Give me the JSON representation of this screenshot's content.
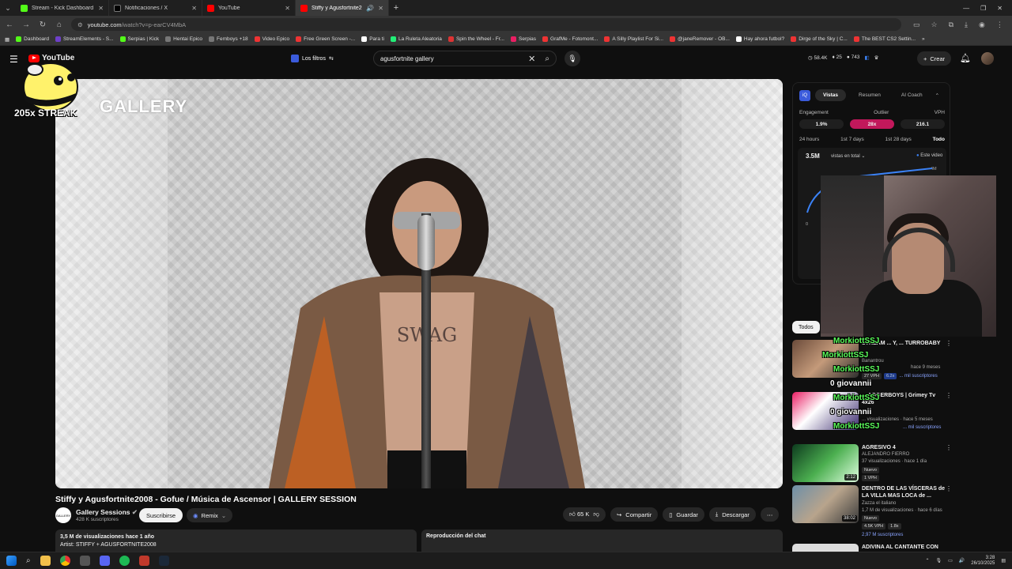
{
  "browser": {
    "tabs": [
      {
        "title": "Stream - Kick Dashboard",
        "color": "#53fc18"
      },
      {
        "title": "Notificaciones / X",
        "color": "#ffffff"
      },
      {
        "title": "YouTube",
        "color": "#ff0000"
      },
      {
        "title": "Stiffy y Agusfortnite2008",
        "color": "#ff0000"
      }
    ],
    "url_domain": "youtube.com",
    "url_path": "/watch?v=p-earCV4MbA",
    "bookmarks": [
      "Dashboard",
      "StreamElements - S...",
      "Serpias | Kick",
      "Hentai Epico",
      "Femboys +18",
      "Video Epico",
      "Free Green Screen -...",
      "Para ti",
      "La Ruleta Aleatoria",
      "Spin the Wheel - Fr...",
      "Serpias",
      "GrafMe - Fotomont...",
      "A Silly Playlist For Si...",
      "@janeRemover - OB...",
      "Hay ahora futbol?",
      "Dirge of the Sky | C...",
      "The BEST CS2 Settin..."
    ]
  },
  "header": {
    "logo_text": "YouTube",
    "filters_label": "Los filtros",
    "search_query": "agusfortnite gallery",
    "stats": [
      "58.4K",
      "25",
      "743"
    ],
    "create_label": "Crear"
  },
  "overlay": {
    "streak": "205x STREAK",
    "gallery_watermark": "GALLERY"
  },
  "video": {
    "title": "Stiffy y Agusfortnite2008 - Gofue / Música de Ascensor | GALLERY SESSION",
    "channel": "Gallery Sessions",
    "channel_avatar_text": "GALLERY",
    "subscribers": "428 K suscriptores",
    "subscribe_label": "Suscribirse",
    "remix_label": "Remix",
    "likes": "65 K",
    "share_label": "Compartir",
    "save_label": "Guardar",
    "download_label": "Descargar",
    "desc_line1": "3,5 M de visualizaciones  hace 1 año",
    "desc_line2": "Artist: STIFFY + AGUSFORTNITE2008",
    "chat_title": "Reproducción del chat"
  },
  "analytics": {
    "tabs": [
      "Vistas",
      "Resumen",
      "AI Coach"
    ],
    "metric_labels": [
      "Engagement",
      "Outlier",
      "VPH"
    ],
    "metric_values": [
      "1.9%",
      "28x",
      "216.1"
    ],
    "time_ranges": [
      "24 hours",
      "1st 7 days",
      "1st 28 days",
      "Todo"
    ],
    "total": "3.5M",
    "selector": "vistas en total",
    "legend": "Este video",
    "chart_max": "4M",
    "chart_min": "0"
  },
  "filter_chip": "Todos",
  "recommendations": [
    {
      "title": "STREAM ... Y, ... TURROBABY",
      "channel": "Banantrou",
      "meta": "hace 9 meses",
      "badges": [
        "27 VPH",
        "6.2x"
      ],
      "subs": "... mil suscriptores",
      "duration": ""
    },
    {
      "title": "... AGGERBOYS | Grimey Tv 4x26",
      "channel": "",
      "meta": "... visualizaciones · hace 5 meses",
      "badges": [],
      "subs": "... mil suscriptores",
      "duration": ""
    },
    {
      "title": "AGRESIVO 4",
      "channel": "ALEJANDRO FIERRO",
      "meta": "37 visualizaciones · hace 1 día",
      "badges": [
        "Nuevo",
        "1 VPH"
      ],
      "subs": "",
      "duration": "2:12"
    },
    {
      "title": "DENTRO DE LAS VÍSCERAS de LA VILLA MAS LOCA de ...",
      "channel": "Zazza el italiano",
      "meta": "1,7 M de visualizaciones · hace 6 días",
      "badges": [
        "Nuevo",
        "4.5K VPH",
        "1.8x"
      ],
      "subs": "2,97 M suscriptores",
      "duration": "38:02"
    },
    {
      "title": "ADIVINA AL CANTANTE CON",
      "channel": "",
      "meta": "",
      "badges": [],
      "subs": "",
      "duration": ""
    }
  ],
  "chat_overlay": [
    {
      "user": "MorkiottSSJ",
      "green": true
    },
    {
      "user": "MorkiottSSJ",
      "green": true
    },
    {
      "user": "MorkiottSSJ",
      "green": true
    },
    {
      "user": "0  giovannii",
      "green": false
    },
    {
      "user": "MorkiottSSJ",
      "green": true
    },
    {
      "user": "0  giovannii",
      "green": false
    },
    {
      "user": "MorkiottSSJ",
      "green": true
    }
  ],
  "taskbar": {
    "time": "3:28",
    "date": "26/10/2025"
  }
}
